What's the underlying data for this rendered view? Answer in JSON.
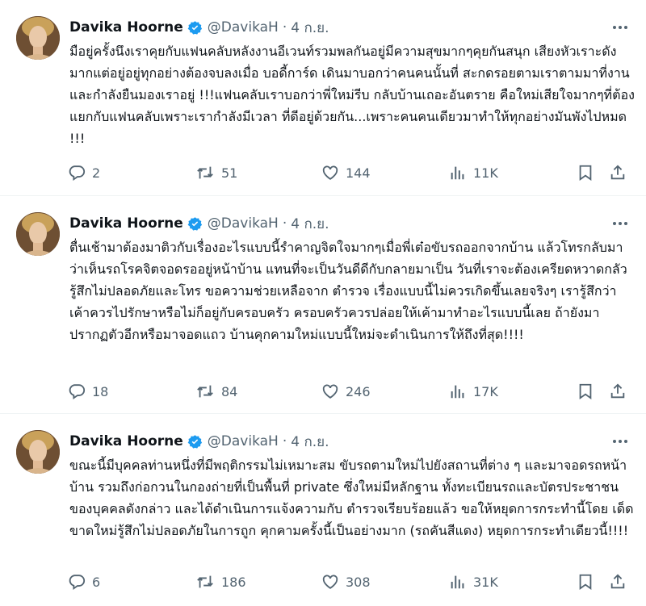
{
  "colors": {
    "text": "#0f1419",
    "muted": "#536471",
    "verified": "#1d9bf0",
    "divider": "#eff3f4"
  },
  "icons": {
    "verified": "verified-badge-icon",
    "more": "more-options-icon",
    "reply": "reply-icon",
    "retweet": "retweet-icon",
    "like": "like-icon",
    "views": "views-icon",
    "bookmark": "bookmark-icon",
    "share": "share-icon"
  },
  "tweets": [
    {
      "name": "Davika Hoorne",
      "handle": "@DavikaH",
      "separator": "·",
      "date": "4 ก.ย.",
      "text": "มือยู่ครั้งนึงเราคุยกับแฟนคลับหลังงานอีเวนท์รวมพลกันอยู่มีความสุขมากๆคุยกันสนุก เสียงหัวเราะดังมากแต่อยู่อยู่ทุกอย่างต้องจบลงเมื่อ บอดี้การ์ด เดินมาบอกว่าคนคนนั้นที่ สะกดรอยตามเราตามมาที่งาน และกำลังยืนมองเราอยู่ !!!แฟนคลับเราบอกว่าพี่ใหม่รีบ กลับบ้านเถอะอันตราย คือใหม่เสียใจมากๆที่ต้องแยกกับแฟนคลับเพราะเรากำลังมีเวลา ที่ดีอยู่ด้วยกัน...เพราะคนคนเดียวมาทำให้ทุกอย่างมันพังไปหมด !!!",
      "replies": "2",
      "retweets": "51",
      "likes": "144",
      "views": "11K"
    },
    {
      "name": "Davika Hoorne",
      "handle": "@DavikaH",
      "separator": "·",
      "date": "4 ก.ย.",
      "text": "ตื่นเช้ามาต้องมาติวกับเรื่องอะไรแบบนี้รำคาญจิตใจมากๆเมื่อพี่เต๋อขับรถออกจากบ้าน แล้วโทรกลับมาว่าเห็นรถโรคจิตจอดรออยู่หน้าบ้าน แทนที่จะเป็นวันดีดีกับกลายมาเป็น วันที่เราจะต้องเครียดหวาดกลัวรู้สึกไม่ปลอดภัยและโทร ขอความช่วยเหลือจาก ตำรวจ เรื่องแบบนี้ไม่ควรเกิดขึ้นเลยจริงๆ เรารู้สึกว่าเค้าควรไปรักษาหรือไม่ก็อยู่กับครอบครัว ครอบครัวควรปล่อยให้เค้ามาทำอะไรแบบนี้เลย ถ้ายังมาปรากฏตัวอีกหรือมาจอดแถว บ้านคุกคามใหม่แบบนี้ใหม่จะดำเนินการให้ถึงที่สุด!!!!",
      "replies": "18",
      "retweets": "84",
      "likes": "246",
      "views": "17K"
    },
    {
      "name": "Davika Hoorne",
      "handle": "@DavikaH",
      "separator": "·",
      "date": "4 ก.ย.",
      "text": "ขณะนี้มีบุคคลท่านหนึ่งที่มีพฤติกรรมไม่เหมาะสม ขับรถตามใหม่ไปยังสถานที่ต่าง ๆ และมาจอดรถหน้าบ้าน รวมถึงก่อกวนในกองถ่ายที่เป็นพื้นที่ private ซึ่งใหม่มีหลักฐาน ทั้งทะเบียนรถและบัตรประชาชนของบุคคลดังกล่าว และได้ดำเนินการแจ้งความกับ ตำรวจเรียบร้อยแล้ว ขอให้หยุดการกระทำนี้โดย เด็ดขาดใหม่รู้สึกไม่ปลอดภัยในการถูก คุกคามครั้งนี้เป็นอย่างมาก (รถคันสีแดง) หยุดการกระทำเดียวนี้!!!!",
      "replies": "6",
      "retweets": "186",
      "likes": "308",
      "views": "31K"
    }
  ]
}
